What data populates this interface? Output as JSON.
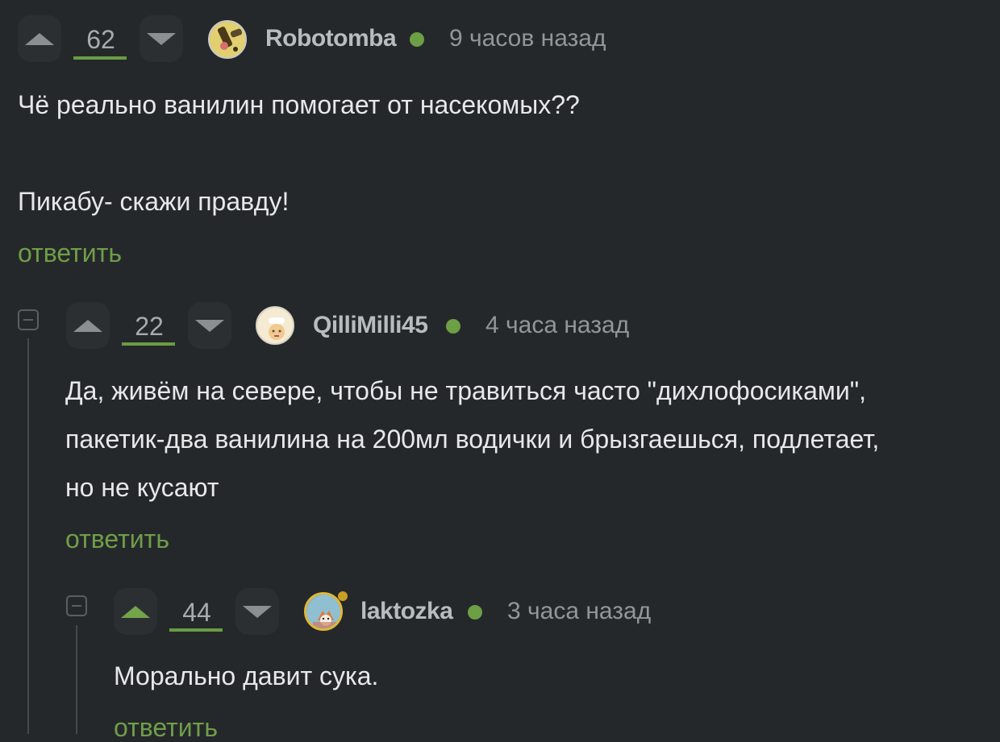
{
  "comments": [
    {
      "score": "62",
      "username": "Robotomba",
      "time": "9 часов назад",
      "lines": [
        "Чё реально ванилин помогает от насекомых??",
        "",
        "Пикабу- скажи правду!"
      ],
      "reply_label": "ответить"
    },
    {
      "score": "22",
      "username": "QilliMilli45",
      "time": "4 часа назад",
      "lines": [
        "Да, живём на севере, чтобы не травиться часто \"дихлофосиками\",",
        "пакетик-два ванилина на 200мл водички и брызгаешься, подлетает,",
        "но не кусают"
      ],
      "reply_label": "ответить"
    },
    {
      "score": "44",
      "username": "laktozka",
      "time": "3 часа назад",
      "lines": [
        "Морально давит сука."
      ],
      "reply_label": "ответить"
    }
  ],
  "colors": {
    "background": "#25282b",
    "accent_green": "#6f9e48",
    "online": "#6d9f45",
    "text": "#e7e8e8",
    "muted": "#92969a"
  },
  "icons": {
    "upvote": "triangle-up-icon",
    "downvote": "triangle-down-icon",
    "collapse": "minus-square-icon",
    "online": "online-dot-icon"
  }
}
